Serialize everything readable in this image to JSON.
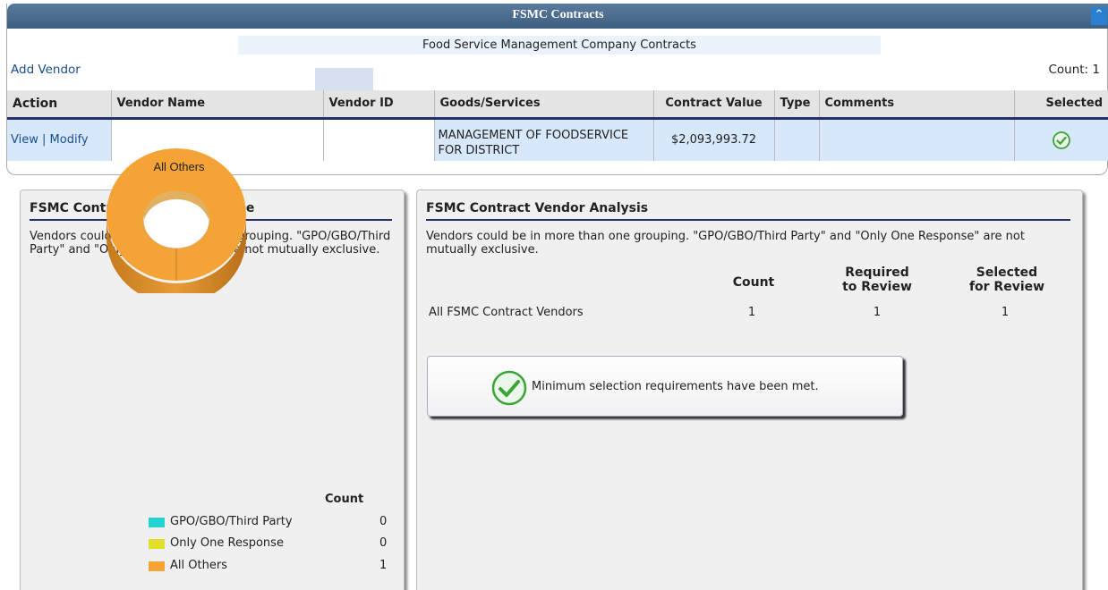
{
  "top": {
    "title": "FSMC Contracts",
    "subtitle": "Food Service Management Company Contracts",
    "add_vendor": "Add Vendor",
    "count": "Count: 1",
    "collapse_icon": "double-chevron-up-icon"
  },
  "table": {
    "headers": [
      "Action",
      "Vendor Name",
      "Vendor ID",
      "Goods/Services",
      "Contract Value",
      "Type",
      "Comments",
      "Selected"
    ],
    "row": {
      "view": "View",
      "sep": "|",
      "modify": "Modify",
      "vendor_name": "",
      "vendor_id": "",
      "goods": "MANAGEMENT OF FOODSERVICE FOR DISTRICT",
      "contract_value": "$2,093,993.72",
      "type": "",
      "comments": "",
      "selected_icon": "check-circle-icon"
    }
  },
  "left_panel": {
    "title": "FSMC Contract Vendors by Type",
    "description": "Vendors could be in more than one grouping. \"GPO/GBO/Third Party\" and \"Only One Response\" are not mutually exclusive.",
    "legend_header": "Count",
    "chart_data": {
      "type": "pie",
      "categories": [
        "GPO/GBO/Third Party",
        "Only One Response",
        "All Others"
      ],
      "values": [
        0,
        0,
        1
      ],
      "colors": [
        "#22d3d3",
        "#e0e02a",
        "#f4a436"
      ],
      "slice_labels": [
        "",
        "",
        "All Others"
      ],
      "legend_position": "bottom-right"
    }
  },
  "right_panel": {
    "title": "FSMC Contract Vendor Analysis",
    "description": "Vendors could be in more than one grouping. \"GPO/GBO/Third Party\" and \"Only One Response\" are not mutually exclusive.",
    "col_count": "Count",
    "col_required_1": "Required",
    "col_required_2": "to Review",
    "col_selected_1": "Selected",
    "col_selected_2": "for Review",
    "row_label": "All FSMC Contract Vendors",
    "row_count": "1",
    "row_required": "1",
    "row_selected": "1",
    "message": "Minimum selection requirements have been met.",
    "message_icon": "check-circle-icon"
  },
  "colors": {
    "title_bar": "#4a6a8c",
    "header_rule": "#25306a",
    "row_bg": "#d8e8fb",
    "check_green": "#3aa535"
  }
}
